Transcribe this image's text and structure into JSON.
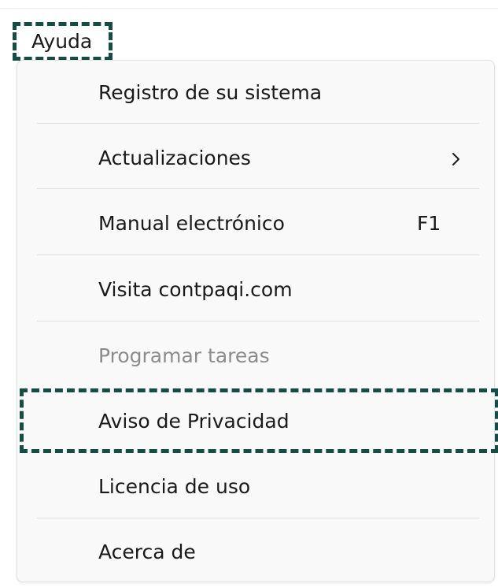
{
  "menubar": {
    "ayuda_label": "Ayuda"
  },
  "menu": {
    "items": [
      {
        "label": "Registro de su sistema",
        "shortcut": "",
        "has_submenu": false,
        "disabled": false
      },
      {
        "label": "Actualizaciones",
        "shortcut": "",
        "has_submenu": true,
        "disabled": false
      },
      {
        "label": "Manual electrónico",
        "shortcut": "F1",
        "has_submenu": false,
        "disabled": false
      },
      {
        "label": "Visita contpaqi.com",
        "shortcut": "",
        "has_submenu": false,
        "disabled": false
      },
      {
        "label": "Programar tareas",
        "shortcut": "",
        "has_submenu": false,
        "disabled": true
      },
      {
        "label": "Aviso de Privacidad",
        "shortcut": "",
        "has_submenu": false,
        "disabled": false
      },
      {
        "label": "Licencia de uso",
        "shortcut": "",
        "has_submenu": false,
        "disabled": false
      },
      {
        "label": "Acerca de",
        "shortcut": "",
        "has_submenu": false,
        "disabled": false
      }
    ]
  },
  "icons": {
    "submenu": "chevron-right-icon"
  },
  "colors": {
    "highlight": "#154c43",
    "text": "#1a1a1a",
    "disabled_text": "#8c8c8c",
    "menu_background": "#f9f9f9",
    "divider": "#dedede"
  }
}
